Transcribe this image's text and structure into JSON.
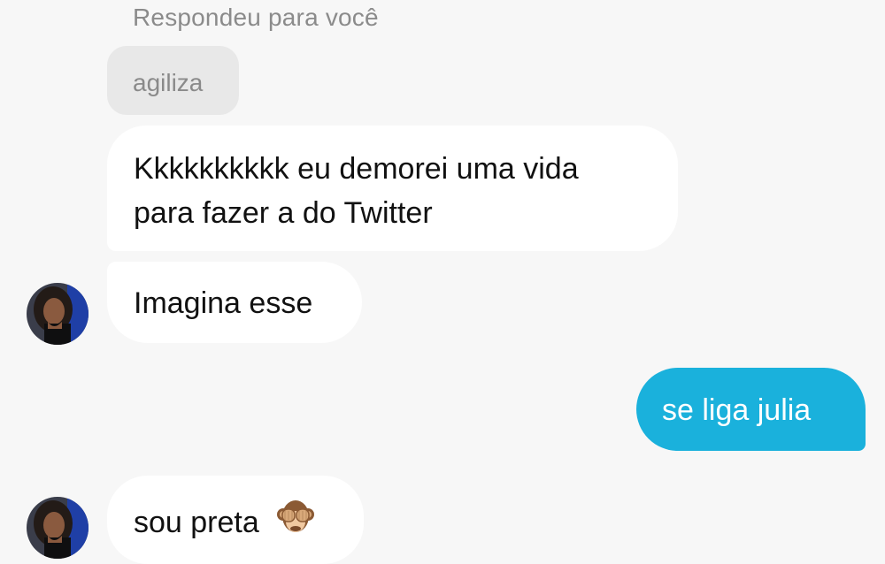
{
  "conversation": {
    "reply_label": "Respondeu para você",
    "quoted_message": "agiliza",
    "messages": [
      {
        "sender": "me",
        "text": "Kkkkkkkkkk eu demorei uma vida para fazer a do Twitter",
        "lines": [
          "Kkkkkkkkkk eu demorei uma vida",
          "para fazer a do Twitter"
        ]
      },
      {
        "sender": "contact",
        "text": "Imagina esse"
      },
      {
        "sender": "me",
        "text": "se liga julia"
      },
      {
        "sender": "contact",
        "text": "sou preta"
      }
    ],
    "emoji_name": "see-no-evil-monkey",
    "colors": {
      "outgoing_bubble": "#1ab1dc",
      "incoming_bubble": "#ffffff",
      "quoted_bubble": "#e8e8e8",
      "background": "#f7f7f7"
    }
  }
}
